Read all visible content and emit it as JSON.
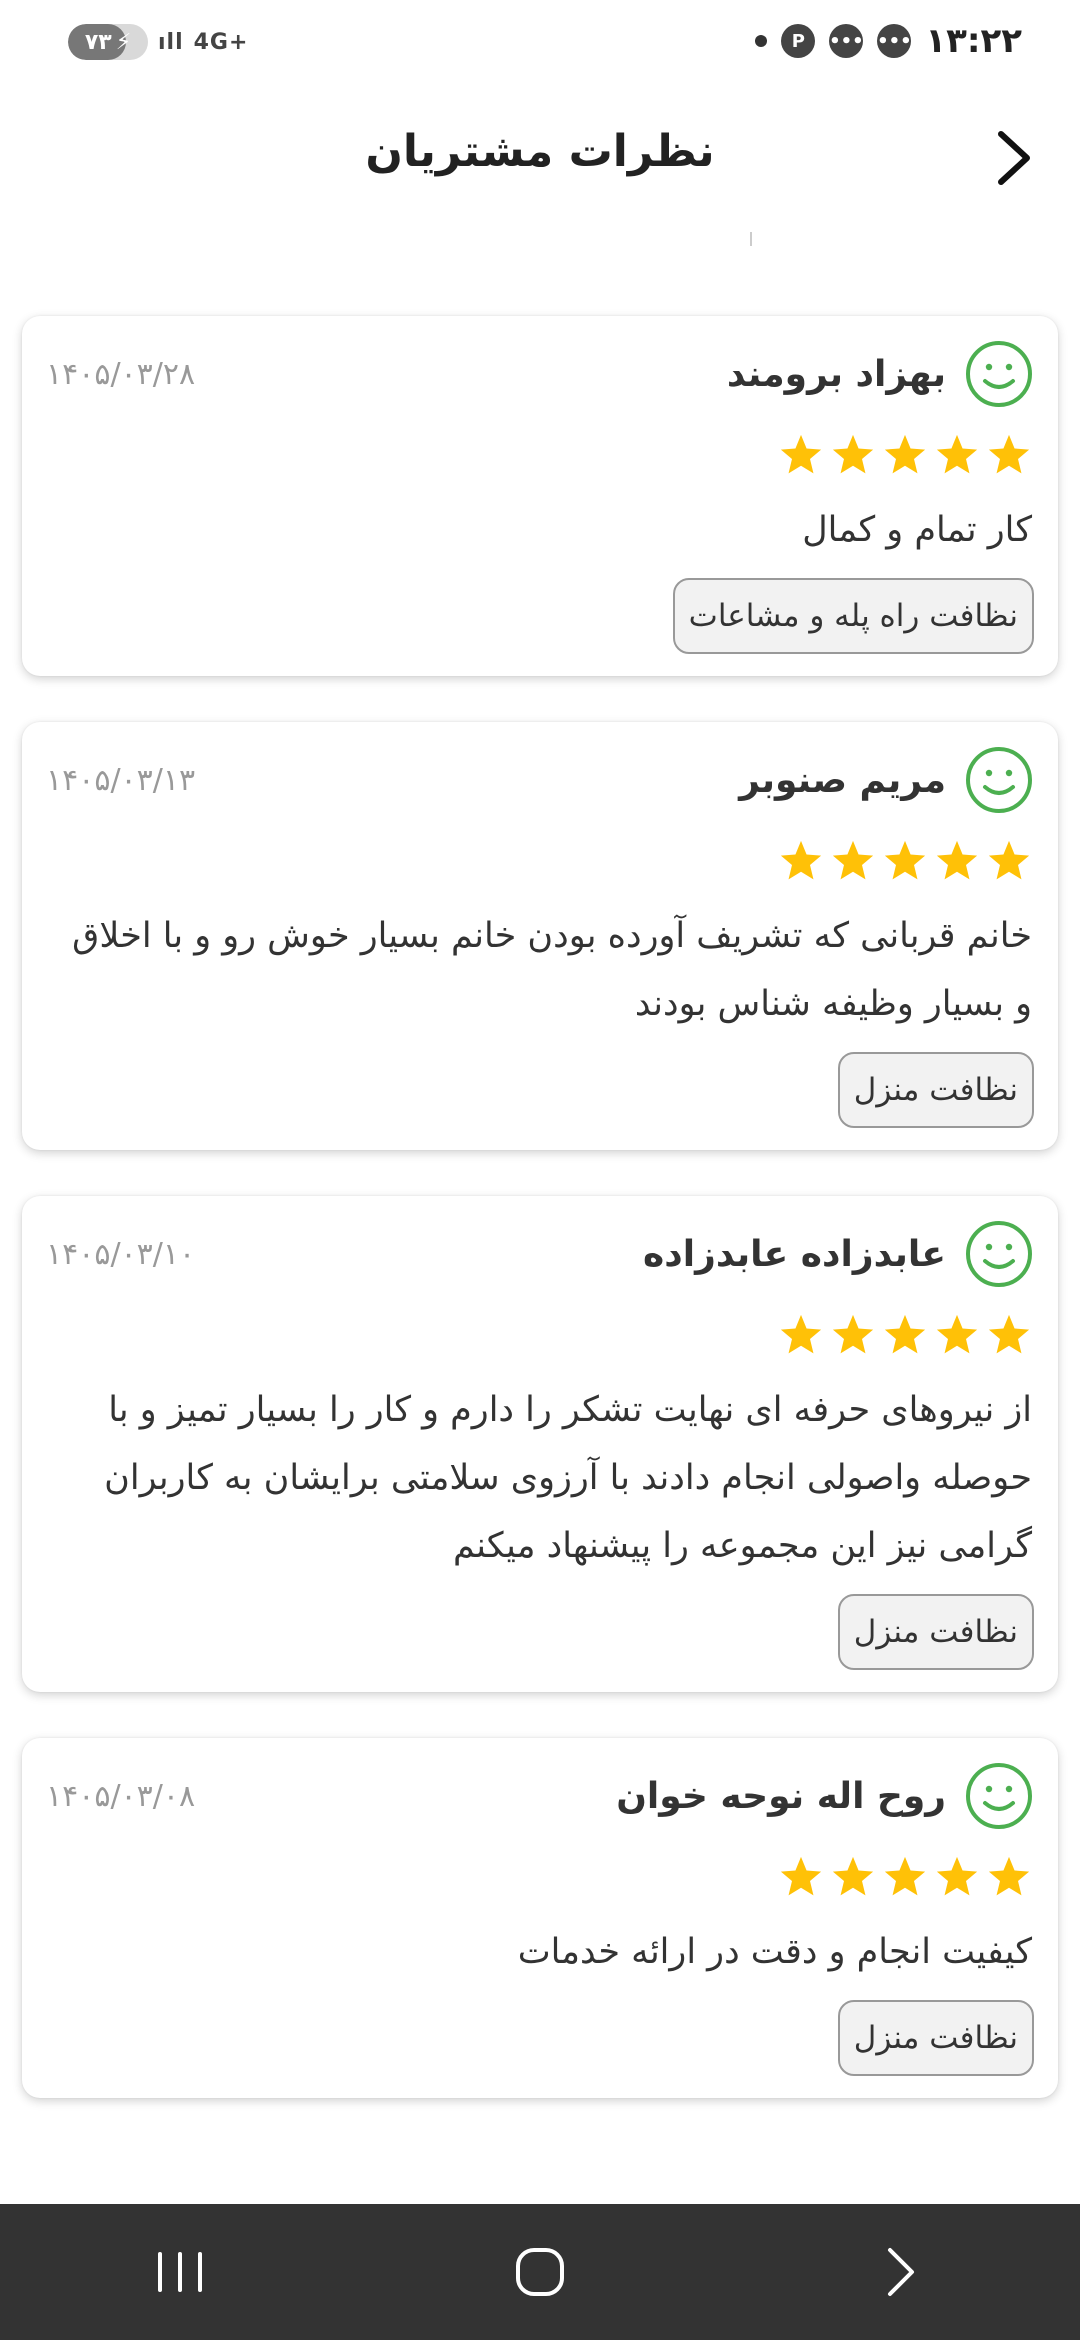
{
  "status_bar": {
    "time": "۱۳:۲۲",
    "battery": "۷۳",
    "battery_level_percent": 73,
    "network": "4G+",
    "icons": [
      "chat-bubble-icon",
      "chat-bubble-icon",
      "pinterest-icon",
      "dot-icon"
    ]
  },
  "header": {
    "title": "نظرات مشتریان",
    "back_icon": "chevron-right-icon"
  },
  "colors": {
    "smiley": "#4caf50",
    "star": "#ffc107",
    "nav_bar": "#333333"
  },
  "reviews": [
    {
      "name": "بهزاد برومند",
      "date": "۱۴۰۵/۰۳/۲۸",
      "rating": 5,
      "comment": "کار تمام و کمال",
      "tag": "نظافت راه پله و مشاعات"
    },
    {
      "name": "مریم صنوبر",
      "date": "۱۴۰۵/۰۳/۱۳",
      "rating": 5,
      "comment": "خانم قربانی که تشریف آورده بودن خانم بسیار خوش رو و با اخلاق و بسیار وظیفه شناس بودند",
      "tag": "نظافت منزل"
    },
    {
      "name": "عابدزاده عابدزاده",
      "date": "۱۴۰۵/۰۳/۱۰",
      "rating": 5,
      "comment": "از نیروهای حرفه ای نهایت تشکر را دارم و کار را بسیار تمیز و با حوصله واصولی انجام دادند با آرزوی سلامتی برایشان به کاربران گرامی نیز این مجموعه را پیشنهاد میکنم",
      "tag": "نظافت منزل"
    },
    {
      "name": "روح اله نوحه خوان",
      "date": "۱۴۰۵/۰۳/۰۸",
      "rating": 5,
      "comment": "کیفیت انجام و دقت در ارائه خدمات",
      "tag": "نظافت منزل"
    }
  ],
  "nav_bar": {
    "buttons": [
      "recent-apps-icon",
      "home-icon",
      "back-icon"
    ]
  }
}
